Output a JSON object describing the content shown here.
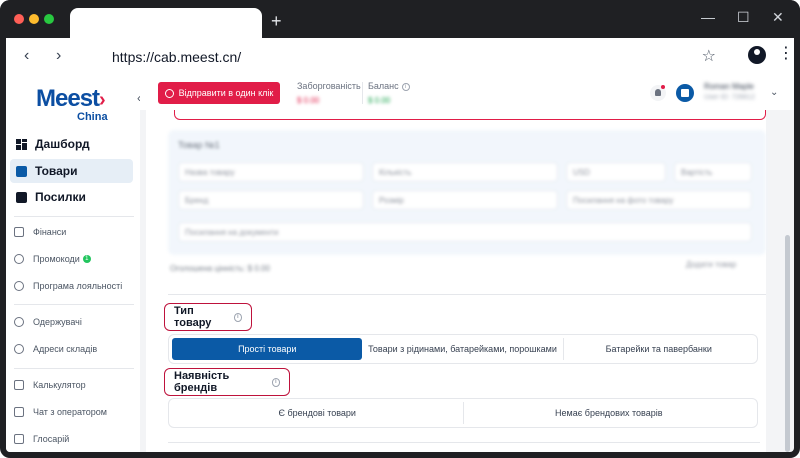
{
  "browser": {
    "url": "https://cab.meest.cn/"
  },
  "sidebar": {
    "logo_main": "Meest",
    "logo_sub": "China",
    "main_items": [
      {
        "label": "Дашборд"
      },
      {
        "label": "Товари"
      },
      {
        "label": "Посилки"
      }
    ],
    "group1": [
      {
        "label": "Фінанси"
      },
      {
        "label": "Промокоди",
        "badge": "1"
      },
      {
        "label": "Програма лояльності"
      }
    ],
    "group2": [
      {
        "label": "Одержувачі"
      },
      {
        "label": "Адреси складів"
      }
    ],
    "group3": [
      {
        "label": "Калькулятор"
      },
      {
        "label": "Чат з оператором"
      },
      {
        "label": "Глосарій"
      }
    ]
  },
  "topbar": {
    "send_button": "Відправити в один клік",
    "debt_label": "Заборгованість",
    "debt_value": "$ 0.00",
    "balance_label": "Баланс",
    "balance_value": "$ 0.00",
    "user_name": "Roman Maple",
    "user_id": "User ID: 726612"
  },
  "form": {
    "item_title": "Товар №1",
    "fields": {
      "product_name": "Назва товару",
      "quantity": "Кількість",
      "currency": "USD",
      "price": "Вартість",
      "brand": "Бренд",
      "size": "Розмір",
      "link": "Посилання на фото товару",
      "description": "Посилання на документи"
    },
    "total": "Оголошена цінність: $ 0.00",
    "add_item": "Додати товар",
    "product_type": {
      "label": "Тип товару",
      "options": [
        "Прості товари",
        "Товари з рідинами, батарейками, порошками",
        "Батарейки та павербанки"
      ],
      "selected": "Прості товари"
    },
    "brands": {
      "label": "Наявність брендів",
      "options": [
        "Є брендові товари",
        "Немає брендових товарів"
      ]
    }
  },
  "colors": {
    "brand_blue": "#0b5aa6",
    "accent_red": "#e11d48",
    "highlight_border": "#be123c"
  }
}
